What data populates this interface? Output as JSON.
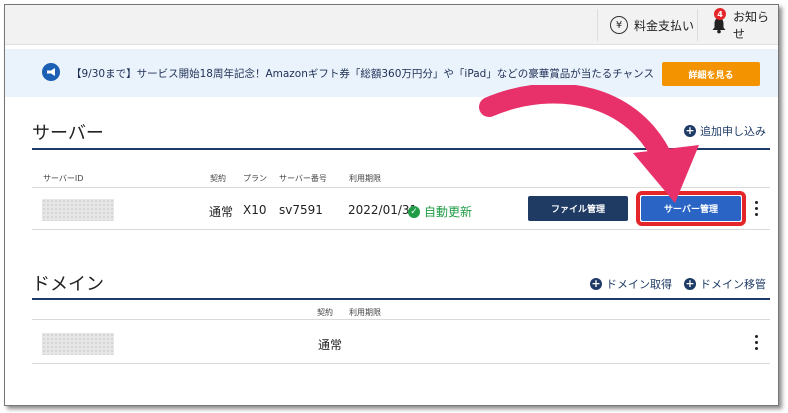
{
  "header": {
    "billing_label": "料金支払い",
    "notifications_label": "お知らせ",
    "notification_count": "4"
  },
  "banner": {
    "text": "【9/30まで】サービス開始18周年記念！Amazonギフト券「総額360万円分」や「iPad」などの豪華賞品が当たるチャンス",
    "button_label": "詳細を見る"
  },
  "server_section": {
    "title": "サーバー",
    "add_label": "追加申し込み",
    "columns": [
      "サーバーID",
      "契約",
      "プラン",
      "サーバー番号",
      "利用期限"
    ],
    "rows": [
      {
        "contract": "通常",
        "plan": "X10",
        "server_number": "sv7591",
        "expiry": "2022/01/31",
        "status": "自動更新",
        "file_button": "ファイル管理",
        "server_button": "サーバー管理"
      }
    ]
  },
  "domain_section": {
    "title": "ドメイン",
    "acquire_label": "ドメイン取得",
    "transfer_label": "ドメイン移管",
    "columns": [
      "契約",
      "利用期限"
    ],
    "rows": [
      {
        "contract": "通常"
      }
    ]
  },
  "colors": {
    "accent_navy": "#1e3a66",
    "server_button": "#2a65c6",
    "banner_button": "#f39300",
    "highlight_red": "#e4262b",
    "renew_green": "#1f9c45"
  }
}
